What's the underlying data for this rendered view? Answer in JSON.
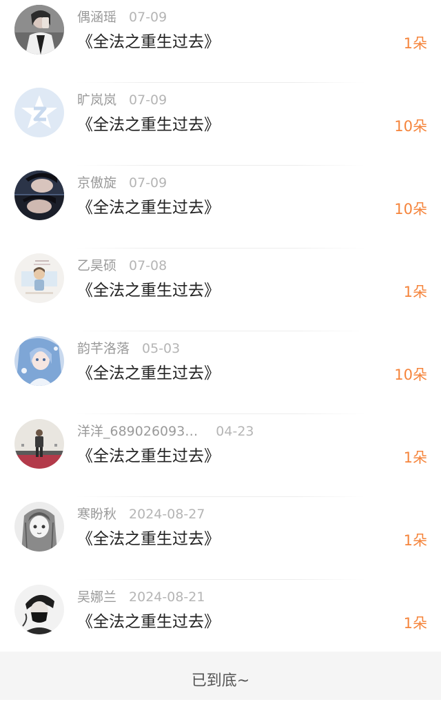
{
  "items": [
    {
      "name": "偶涵瑶",
      "date": "07-09",
      "book": "《全法之重生过去》",
      "gift": "1朵",
      "avatar_icon": "girl-photo-avatar"
    },
    {
      "name": "旷岚岚",
      "date": "07-09",
      "book": "《全法之重生过去》",
      "gift": "10朵",
      "avatar_icon": "default-z-avatar"
    },
    {
      "name": "京傲旋",
      "date": "07-09",
      "book": "《全法之重生过去》",
      "gift": "10朵",
      "avatar_icon": "couple-photo-avatar"
    },
    {
      "name": "乙昊硕",
      "date": "07-08",
      "book": "《全法之重生过去》",
      "gift": "1朵",
      "avatar_icon": "illustration-avatar"
    },
    {
      "name": "韵芊洛落",
      "date": "05-03",
      "book": "《全法之重生过去》",
      "gift": "10朵",
      "avatar_icon": "anime-girl-avatar"
    },
    {
      "name": "洋洋_689026093…",
      "date": "04-23",
      "book": "《全法之重生过去》",
      "gift": "1朵",
      "avatar_icon": "person-standing-avatar"
    },
    {
      "name": "寒盼秋",
      "date": "2024-08-27",
      "book": "《全法之重生过去》",
      "gift": "1朵",
      "avatar_icon": "sketch-girl-avatar"
    },
    {
      "name": "吴娜兰",
      "date": "2024-08-21",
      "book": "《全法之重生过去》",
      "gift": "1朵",
      "avatar_icon": "masked-man-avatar"
    }
  ],
  "footer": {
    "end_text": "已到底~"
  },
  "colors": {
    "gift": "#f5843b",
    "name": "#9a9a9a",
    "title": "#222222",
    "footer_bg": "#f5f5f5"
  }
}
